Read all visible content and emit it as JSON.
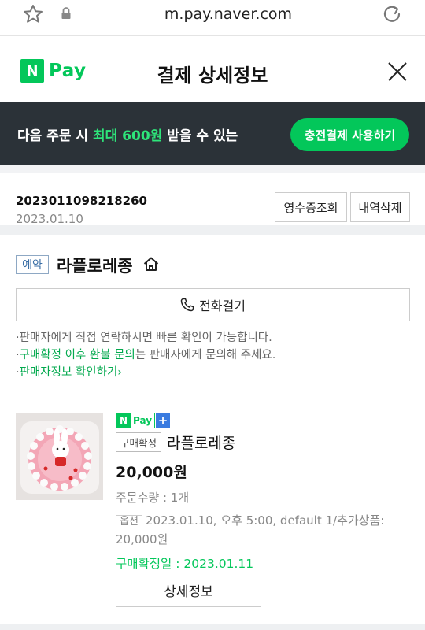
{
  "browser": {
    "url": "m.pay.naver.com",
    "icons": [
      "star-icon",
      "lock-icon",
      "reload-icon"
    ]
  },
  "header": {
    "logo_n": "N",
    "logo_pay": "Pay",
    "title": "결제 상세정보",
    "close_icon": "close-icon"
  },
  "promo": {
    "text_before": "다음 주문 시 ",
    "text_highlight": "최대 600원",
    "text_after": " 받을 수 있는",
    "button": "충전결제 사용하기",
    "colors": {
      "banner_bg": "#2b3238",
      "highlight": "#2ee57a",
      "button_bg": "#03c75a"
    }
  },
  "order": {
    "number": "2023011098218260",
    "date": "2023.01.10",
    "receipt_button": "영수증조회",
    "delete_button": "내역삭제"
  },
  "seller": {
    "badge": "예약",
    "name": "라플로레종",
    "call_button": "전화걸기",
    "note1": "판매자에게 직접 연락하시면 빠른 확인이 가능합니다.",
    "note2_link": "구매확정 이후 환불 문의",
    "note2_rest": "는 판매자에게 문의해 주세요.",
    "note3_link": "판매자정보 확인하기",
    "bullet": "·",
    "link_arrow": "›"
  },
  "product": {
    "npay_n": "N",
    "npay_pay": "Pay",
    "npay_plus": "+",
    "status_tag": "구매확정",
    "name": "라플로레종",
    "price": "20,000원",
    "quantity": "주문수량 : 1개",
    "option_tag": "옵션",
    "option_text": "2023.01.10, 오후 5:00, default 1/추가상품: 20,000원",
    "confirm_date": "구매확정일 : 2023.01.11",
    "detail_button": "상세정보"
  }
}
